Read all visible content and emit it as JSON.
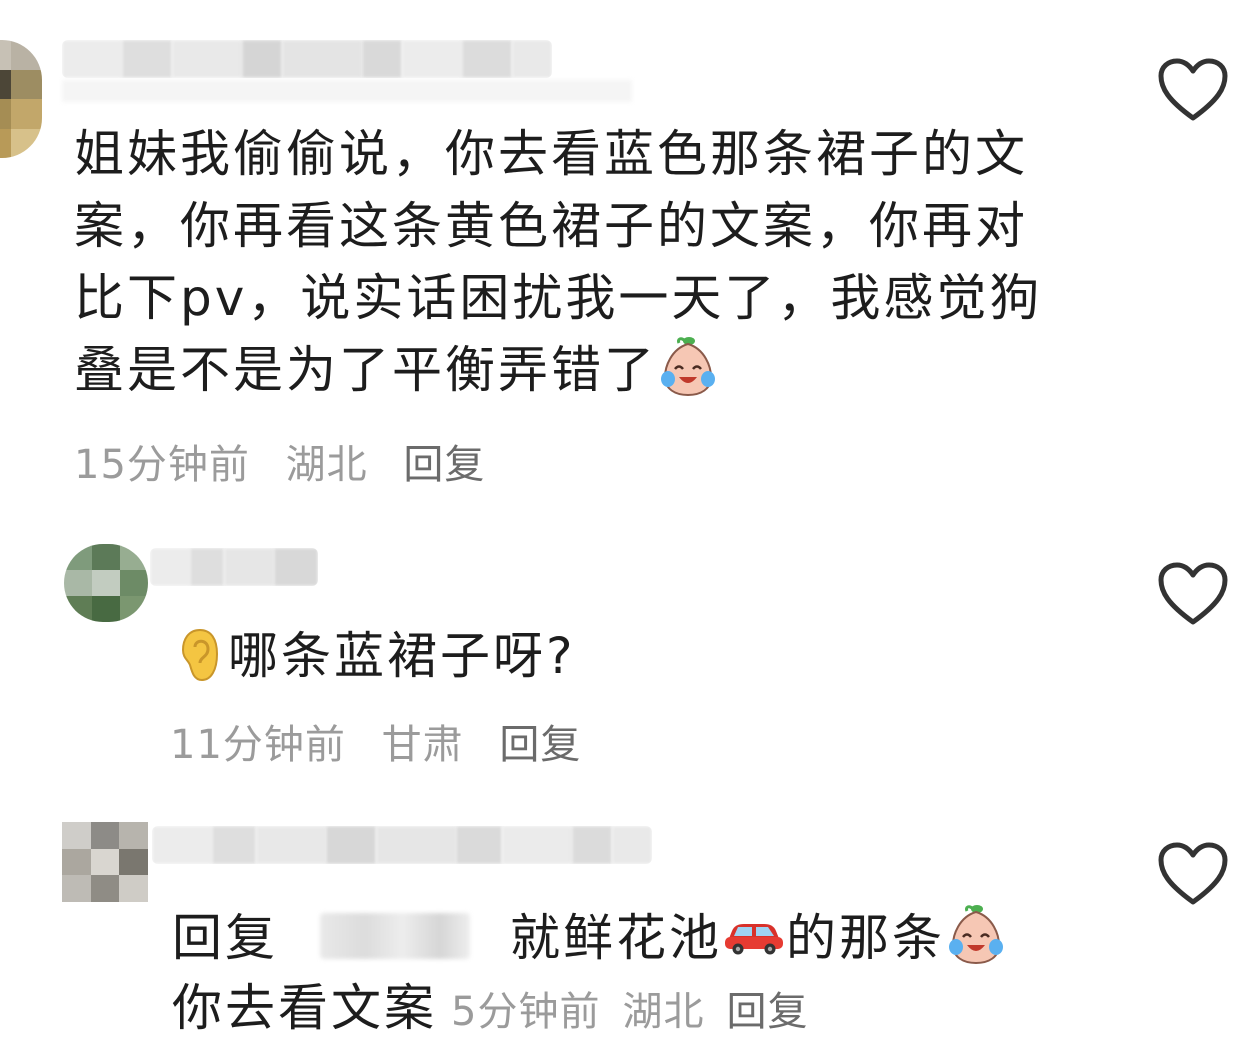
{
  "comments": [
    {
      "text_lines": [
        "姐妹我偷偷说，你去看蓝色那条裙子的文",
        "案，你再看这条黄色裙子的文案，你再对",
        "比下pv，说实话困扰我一天了，我感觉狗",
        "叠是不是为了平衡弄错了"
      ],
      "time": "15分钟前",
      "location": "湖北",
      "reply_label": "回复",
      "emoji": "laughing-crying-baby-emoji"
    },
    {
      "text": "哪条蓝裙子呀?",
      "time": "11分钟前",
      "location": "甘肃",
      "reply_label": "回复",
      "emoji": "ear-emoji"
    },
    {
      "reply_prefix": "回复",
      "text_part1": "就鲜花池",
      "text_part2": "的那条",
      "text_line2": "你去看文案",
      "time": "5分钟前",
      "location": "湖北",
      "reply_label": "回复",
      "emojis": [
        "car-emoji",
        "laughing-crying-baby-emoji"
      ]
    }
  ],
  "icons": {
    "like": "heart-outline-icon"
  },
  "colors": {
    "text": "#1d1d1d",
    "meta": "#9b9b9b",
    "icon": "#333333"
  }
}
